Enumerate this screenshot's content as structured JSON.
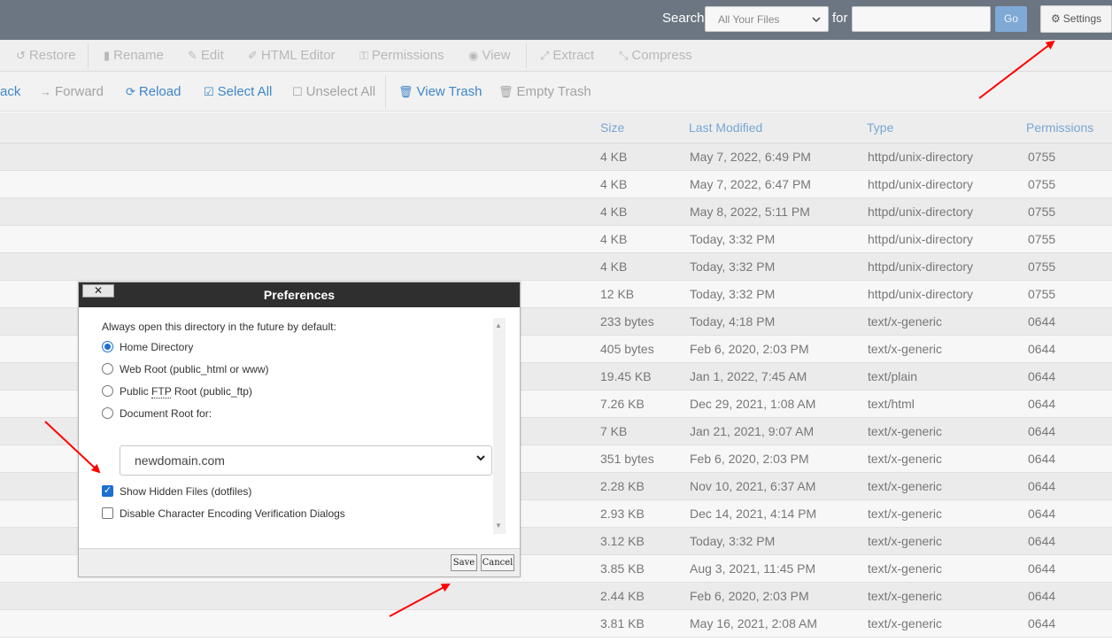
{
  "search": {
    "label": "Search",
    "scope_value": "All Your Files",
    "for_label": "for",
    "query_value": "",
    "go_label": "Go"
  },
  "settings_label": "Settings",
  "toolbar1": {
    "restore": "Restore",
    "rename": "Rename",
    "edit": "Edit",
    "html_editor": "HTML Editor",
    "permissions": "Permissions",
    "view": "View",
    "extract": "Extract",
    "compress": "Compress"
  },
  "toolbar2": {
    "back": "ack",
    "forward": "Forward",
    "reload": "Reload",
    "select_all": "Select All",
    "unselect_all": "Unselect All",
    "view_trash": "View Trash",
    "empty_trash": "Empty Trash"
  },
  "table": {
    "headers": {
      "size": "Size",
      "last_modified": "Last Modified",
      "type": "Type",
      "permissions": "Permissions"
    },
    "rows": [
      {
        "size": "4 KB",
        "modified": "May 7, 2022, 6:49 PM",
        "type": "httpd/unix-directory",
        "perms": "0755"
      },
      {
        "size": "4 KB",
        "modified": "May 7, 2022, 6:47 PM",
        "type": "httpd/unix-directory",
        "perms": "0755"
      },
      {
        "size": "4 KB",
        "modified": "May 8, 2022, 5:11 PM",
        "type": "httpd/unix-directory",
        "perms": "0755"
      },
      {
        "size": "4 KB",
        "modified": "Today, 3:32 PM",
        "type": "httpd/unix-directory",
        "perms": "0755"
      },
      {
        "size": "4 KB",
        "modified": "Today, 3:32 PM",
        "type": "httpd/unix-directory",
        "perms": "0755"
      },
      {
        "size": "12 KB",
        "modified": "Today, 3:32 PM",
        "type": "httpd/unix-directory",
        "perms": "0755"
      },
      {
        "size": "233 bytes",
        "modified": "Today, 4:18 PM",
        "type": "text/x-generic",
        "perms": "0644"
      },
      {
        "size": "405 bytes",
        "modified": "Feb 6, 2020, 2:03 PM",
        "type": "text/x-generic",
        "perms": "0644"
      },
      {
        "size": "19.45 KB",
        "modified": "Jan 1, 2022, 7:45 AM",
        "type": "text/plain",
        "perms": "0644"
      },
      {
        "size": "7.26 KB",
        "modified": "Dec 29, 2021, 1:08 AM",
        "type": "text/html",
        "perms": "0644"
      },
      {
        "size": "7 KB",
        "modified": "Jan 21, 2021, 9:07 AM",
        "type": "text/x-generic",
        "perms": "0644"
      },
      {
        "size": "351 bytes",
        "modified": "Feb 6, 2020, 2:03 PM",
        "type": "text/x-generic",
        "perms": "0644"
      },
      {
        "size": "2.28 KB",
        "modified": "Nov 10, 2021, 6:37 AM",
        "type": "text/x-generic",
        "perms": "0644"
      },
      {
        "size": "2.93 KB",
        "modified": "Dec 14, 2021, 4:14 PM",
        "type": "text/x-generic",
        "perms": "0644"
      },
      {
        "size": "3.12 KB",
        "modified": "Today, 3:32 PM",
        "type": "text/x-generic",
        "perms": "0644"
      },
      {
        "size": "3.85 KB",
        "modified": "Aug 3, 2021, 11:45 PM",
        "type": "text/x-generic",
        "perms": "0644"
      },
      {
        "size": "2.44 KB",
        "modified": "Feb 6, 2020, 2:03 PM",
        "type": "text/x-generic",
        "perms": "0644"
      },
      {
        "size": "3.81 KB",
        "modified": "May 16, 2021, 2:08 AM",
        "type": "text/x-generic",
        "perms": "0644"
      }
    ]
  },
  "modal": {
    "title": "Preferences",
    "close_label": "✕",
    "intro": "Always open this directory in the future by default:",
    "options": {
      "home": "Home Directory",
      "web_root": "Web Root (public_html or www)",
      "ftp_pre": "Public ",
      "ftp_abbr": "FTP",
      "ftp_post": " Root (public_ftp)",
      "doc_root": "Document Root for:"
    },
    "selected_option": "home",
    "domain_value": "newdomain.com",
    "show_hidden_label": "Show Hidden Files (dotfiles)",
    "show_hidden_checked": true,
    "disable_encoding_label": "Disable Character Encoding Verification Dialogs",
    "disable_encoding_checked": false,
    "save_label": "Save",
    "cancel_label": "Cancel"
  },
  "colors": {
    "topbar": "#6b7682",
    "link_blue": "#3f86c7",
    "header_blue": "#78a6d3",
    "annotation_red": "#ff0000",
    "modal_title_bg": "#2f2f2f"
  }
}
